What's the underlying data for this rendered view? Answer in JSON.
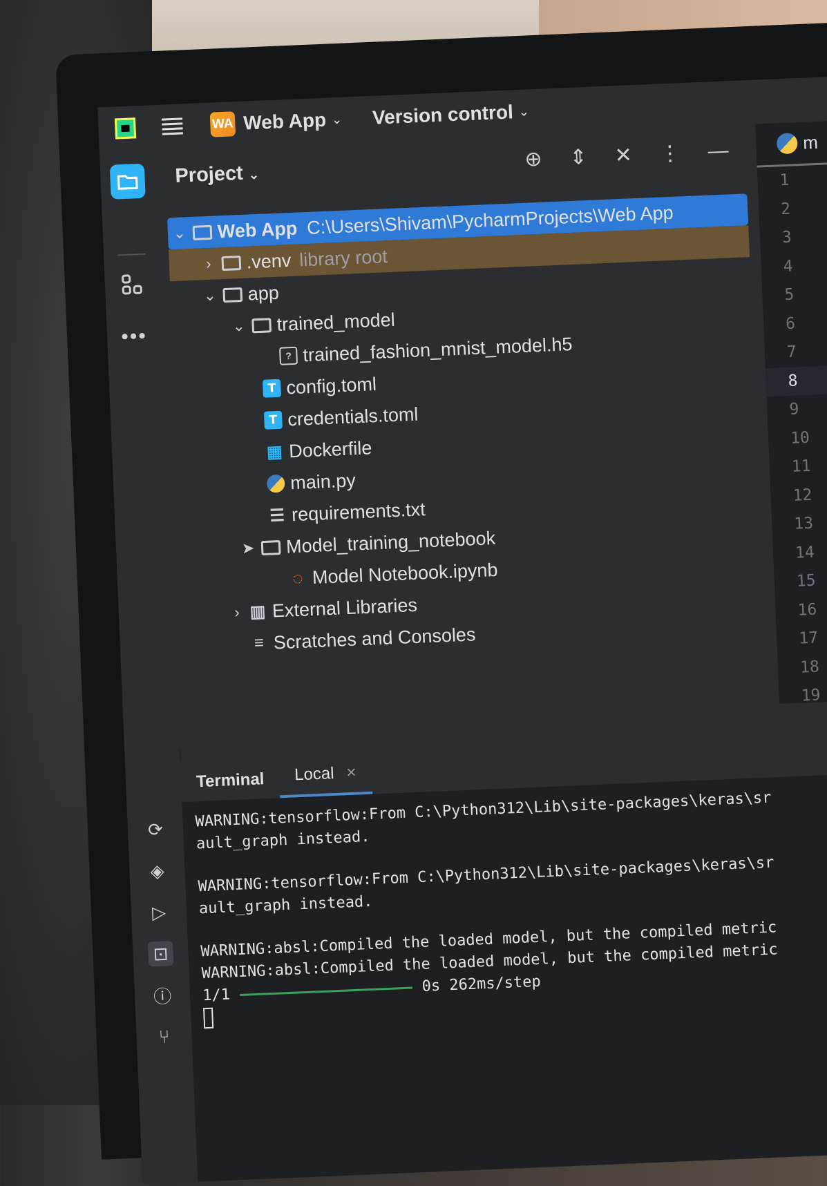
{
  "topbar": {
    "project_badge": "WA",
    "project_name": "Web App",
    "version_control": "Version control"
  },
  "panel": {
    "title": "Project",
    "tree": {
      "root_name": "Web App",
      "root_path": "C:\\Users\\Shivam\\PycharmProjects\\Web App",
      "venv_name": ".venv",
      "venv_note": "library root",
      "app": "app",
      "trained_model": "trained_model",
      "h5_file": "trained_fashion_mnist_model.h5",
      "config": "config.toml",
      "credentials": "credentials.toml",
      "dockerfile": "Dockerfile",
      "main": "main.py",
      "requirements": "requirements.txt",
      "notebook_folder": "Model_training_notebook",
      "notebook_file": "Model Notebook.ipynb",
      "external_libraries": "External Libraries",
      "scratches": "Scratches and Consoles"
    },
    "t_icon": "T",
    "q_icon": "?"
  },
  "editor": {
    "tab_label": "m",
    "line_numbers": [
      "1",
      "2",
      "3",
      "4",
      "5",
      "6",
      "7",
      "8",
      "9",
      "10",
      "11",
      "12",
      "13",
      "14",
      "15",
      "16",
      "17",
      "18",
      "19"
    ],
    "current_line": "8"
  },
  "terminal": {
    "tab_terminal": "Terminal",
    "tab_local": "Local",
    "tab_close": "×",
    "lines": [
      "WARNING:tensorflow:From C:\\Python312\\Lib\\site-packages\\keras\\sr",
      "ault_graph instead.",
      "WARNING:tensorflow:From C:\\Python312\\Lib\\site-packages\\keras\\sr",
      "ault_graph instead.",
      "WARNING:absl:Compiled the loaded model, but the compiled metric",
      "WARNING:absl:Compiled the loaded model, but the compiled metric"
    ],
    "progress_count": "1/1",
    "progress_time": "0s 262ms/step"
  },
  "colors": {
    "accent": "#2fb5f5",
    "selection": "#2f7ad6",
    "venv_highlight": "#6b5535"
  },
  "icons": {
    "app_logo": "pycharm-logo-icon",
    "menu": "hamburger-menu-icon",
    "project_tool": "folder-icon",
    "structure_tool": "structure-icon",
    "more_tool": "more-dots-icon",
    "locate": "crosshair-icon",
    "expand": "expand-all-icon",
    "collapse": "collapse-all-icon",
    "options": "kebab-menu-icon",
    "hide": "minimize-icon"
  }
}
